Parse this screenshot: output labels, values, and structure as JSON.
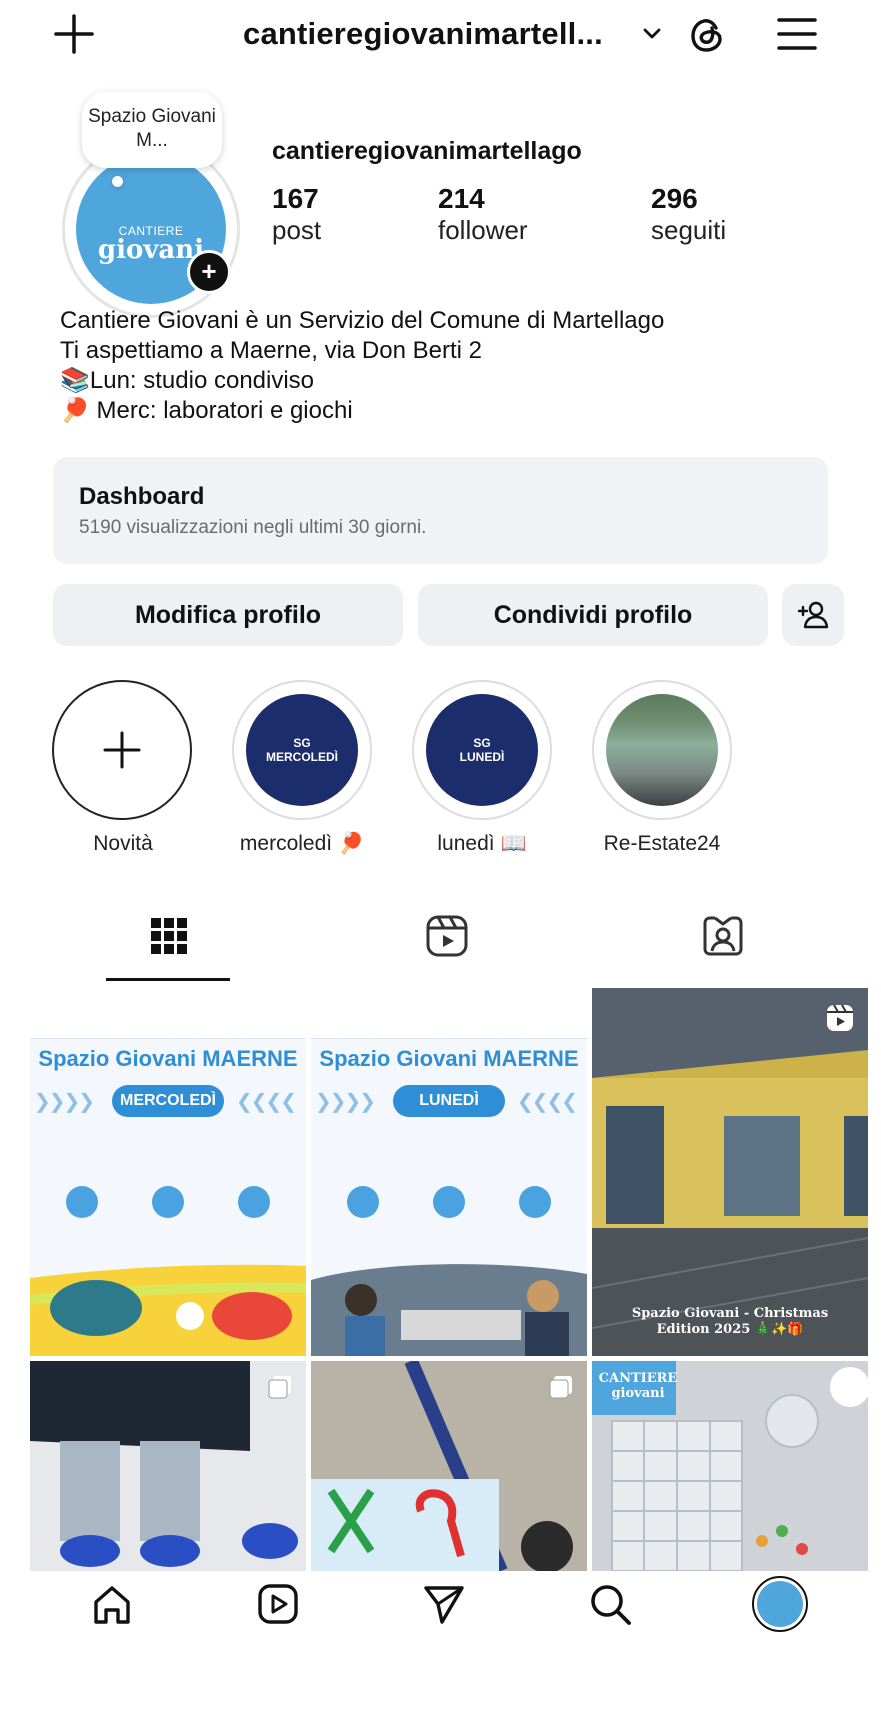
{
  "header": {
    "username_truncated": "cantieregiovanimartell...",
    "icons": [
      "plus-icon",
      "chevron-down-icon",
      "threads-icon",
      "menu-icon"
    ]
  },
  "profile": {
    "note": "Spazio Giovani M...",
    "avatar_text_small": "CANTIERE",
    "avatar_text_big": "giovani",
    "username": "cantieregiovanimartellago",
    "stats": [
      {
        "value": "167",
        "label": "post"
      },
      {
        "value": "214",
        "label": "follower"
      },
      {
        "value": "296",
        "label": "seguiti"
      }
    ],
    "bio": [
      "Cantiere Giovani è un Servizio del Comune di Martellago",
      "Ti aspettiamo a Maerne, via Don Berti 2",
      "📚Lun: studio condiviso",
      "🏓 Merc: laboratori e giochi"
    ]
  },
  "dashboard": {
    "title": "Dashboard",
    "subtitle": "5190 visualizzazioni negli ultimi 30 giorni."
  },
  "buttons": {
    "edit": "Modifica profilo",
    "share": "Condividi profilo"
  },
  "highlights": [
    {
      "label": "Novità",
      "cover": ""
    },
    {
      "label": "mercoledì 🏓",
      "cover": "SG\nMERCOLEDÌ"
    },
    {
      "label": "lunedì 📖",
      "cover": "SG\nLUNEDÌ"
    },
    {
      "label": "Re-Estate24",
      "cover": ""
    }
  ],
  "posts": [
    {
      "type": "poster",
      "title": "Spazio Giovani MAERNE",
      "day": "MERCOLEDÌ"
    },
    {
      "type": "poster",
      "title": "Spazio Giovani MAERNE",
      "day": "LUNEDÌ"
    },
    {
      "type": "reel",
      "caption": "Spazio Giovani - Christmas Edition 2025 🎄✨🎁"
    },
    {
      "type": "photo",
      "caption": ""
    },
    {
      "type": "photo",
      "caption": ""
    },
    {
      "type": "photo",
      "caption": "CANTIERE giovani"
    }
  ],
  "colors": {
    "accent_blue": "#2f8fd6",
    "avatar_blue": "#4fa6dc",
    "highlight_navy": "#1b2d6b",
    "button_bg": "#eef0f3"
  }
}
